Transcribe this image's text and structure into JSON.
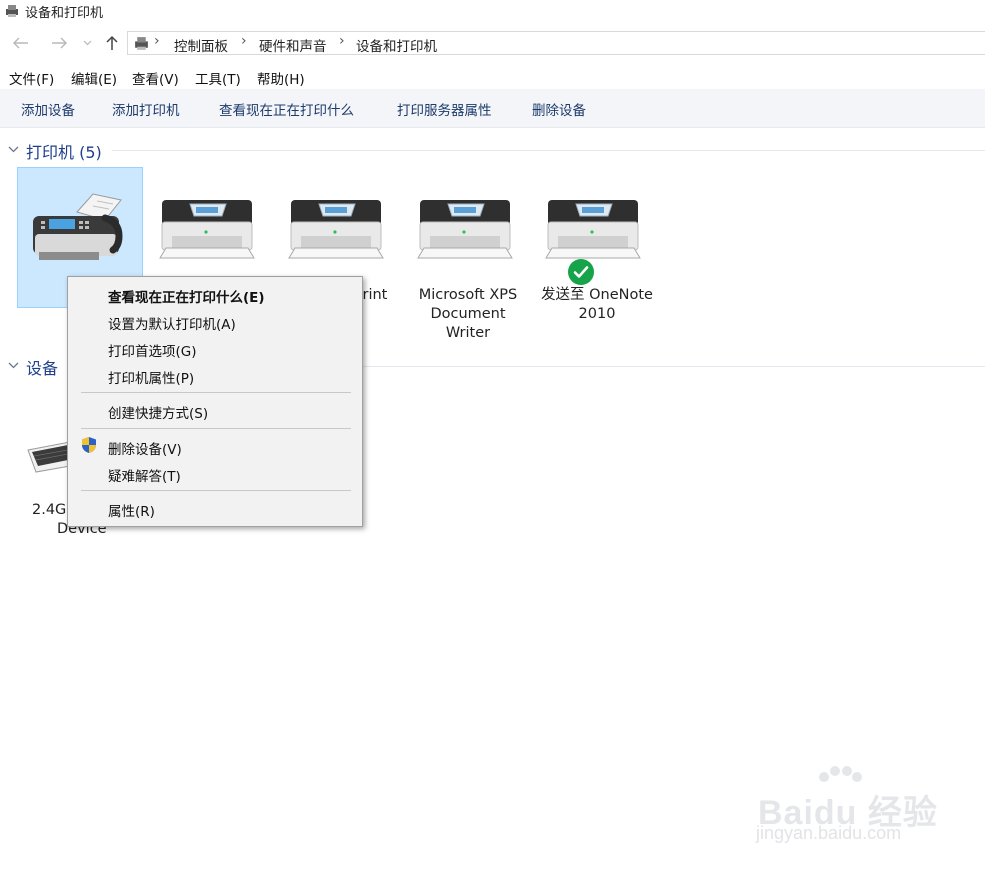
{
  "window": {
    "title": "设备和打印机"
  },
  "breadcrumb": [
    "控制面板",
    "硬件和声音",
    "设备和打印机"
  ],
  "menubar": [
    "文件(F)",
    "编辑(E)",
    "查看(V)",
    "工具(T)",
    "帮助(H)"
  ],
  "commands": [
    "添加设备",
    "添加打印机",
    "查看现在正在打印什么",
    "打印服务器属性",
    "删除设备"
  ],
  "printers_group": {
    "title": "打印机 (5)",
    "items": [
      {
        "label": "",
        "icon": "fax-icon",
        "selected": true
      },
      {
        "label": "Print",
        "icon": "printer-icon"
      },
      {
        "label": "",
        "icon": "printer-icon"
      },
      {
        "label_lines": [
          "Microsoft XPS",
          "Document",
          "Writer"
        ],
        "icon": "printer-icon"
      },
      {
        "label_lines": [
          "发送至 OneNote",
          "2010"
        ],
        "icon": "printer-icon",
        "default": true
      }
    ]
  },
  "devices_group": {
    "title": "设备",
    "items": [
      {
        "label_lines": [
          "2.4G",
          "Device"
        ],
        "icon": "keyboard-icon"
      }
    ]
  },
  "context_menu": {
    "items": [
      {
        "label": "查看现在正在打印什么(E)",
        "bold": true
      },
      {
        "label": "设置为默认打印机(A)"
      },
      {
        "label": "打印首选项(G)"
      },
      {
        "label": "打印机属性(P)"
      },
      {
        "label": "创建快捷方式(S)"
      },
      {
        "label": "删除设备(V)",
        "icon": "uac-shield-icon"
      },
      {
        "label": "疑难解答(T)"
      },
      {
        "label": "属性(R)"
      }
    ]
  },
  "watermark": {
    "brand": "Baidu 经验",
    "url": "jingyan.baidu.com"
  },
  "colors": {
    "accent": "#1e3f8a",
    "selection": "#cce8ff",
    "default_check": "#16a34a"
  }
}
